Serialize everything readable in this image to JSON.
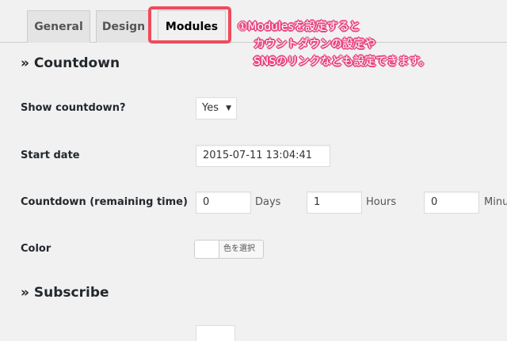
{
  "tabs": [
    {
      "label": "General"
    },
    {
      "label": "Design"
    },
    {
      "label": "Modules"
    }
  ],
  "annotation": {
    "line1": "①Modulesを設定すると",
    "line2": "カウントダウンの設定や",
    "line3": "SNSのリンクなども設定できます。",
    "highlight_color": "#ef4b5c",
    "text_outline_color": "#e8457f"
  },
  "countdown_section": {
    "heading": "» Countdown",
    "show_countdown": {
      "label": "Show countdown?",
      "selected": "Yes"
    },
    "start_date": {
      "label": "Start date",
      "value": "2015-07-11 13:04:41"
    },
    "remaining_time": {
      "label": "Countdown (remaining time)",
      "days_value": "0",
      "days_unit": "Days",
      "hours_value": "1",
      "hours_unit": "Hours",
      "minutes_value": "0",
      "minutes_unit": "Minu"
    },
    "color": {
      "label": "Color",
      "button_label": "色を選択",
      "swatch_color": "#ffffff"
    }
  },
  "subscribe_section": {
    "heading": "» Subscribe"
  }
}
